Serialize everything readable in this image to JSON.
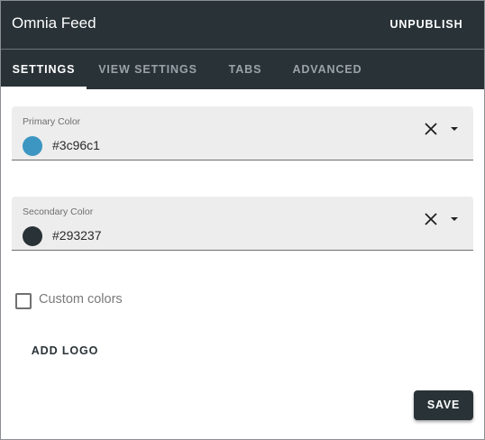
{
  "header": {
    "title": "Omnia Feed",
    "unpublish_label": "UNPUBLISH"
  },
  "tabs": [
    {
      "label": "SETTINGS",
      "active": true
    },
    {
      "label": "VIEW SETTINGS",
      "active": false
    },
    {
      "label": "TABS",
      "active": false
    },
    {
      "label": "ADVANCED",
      "active": false
    }
  ],
  "primary_color": {
    "label": "Primary Color",
    "value": "#3c96c1",
    "swatch": "#3c96c1"
  },
  "secondary_color": {
    "label": "Secondary Color",
    "value": "#293237",
    "swatch": "#293237"
  },
  "custom_colors": {
    "label": "Custom colors",
    "checked": false
  },
  "add_logo_label": "ADD LOGO",
  "save_label": "SAVE",
  "icons": {
    "clear": "close-icon",
    "dropdown": "caret-down-icon",
    "checkbox": "checkbox-unchecked-icon"
  },
  "colors": {
    "header_bg": "#293237",
    "field_bg": "#ededed",
    "save_bg": "#293237"
  }
}
